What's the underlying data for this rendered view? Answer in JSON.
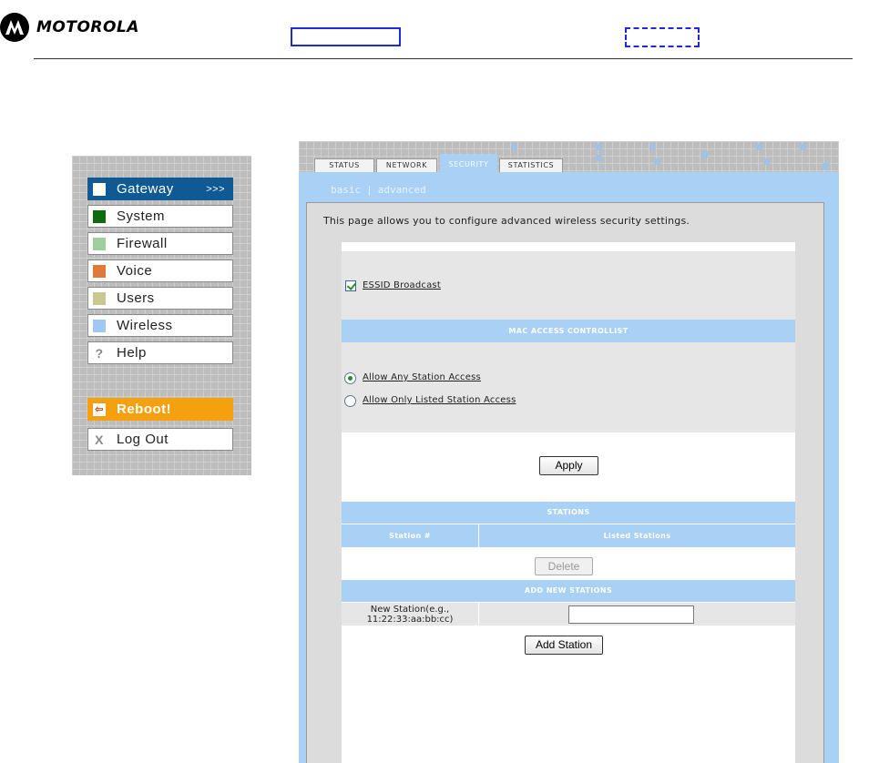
{
  "brand": {
    "name": "MOTOROLA",
    "logo_icon": "motorola-batwing-icon"
  },
  "sidebar": {
    "items": [
      {
        "label": "Gateway",
        "chevron": ">>>",
        "color": "#ffffff"
      },
      {
        "label": "System",
        "color": "#0e6b0e"
      },
      {
        "label": "Firewall",
        "color": "#9fcf9f"
      },
      {
        "label": "Voice",
        "color": "#e07a3a"
      },
      {
        "label": "Users",
        "color": "#c9c98f"
      },
      {
        "label": "Wireless",
        "color": "#9fc9f2"
      },
      {
        "label": "Help",
        "glyph": "?"
      },
      {
        "label": "Reboot!",
        "glyph": "⇦"
      },
      {
        "label": "Log Out",
        "glyph": "X"
      }
    ]
  },
  "tabs": [
    {
      "label": "STATUS"
    },
    {
      "label": "NETWORK"
    },
    {
      "label": "SECURITY",
      "active": true
    },
    {
      "label": "STATISTICS"
    }
  ],
  "subnav": {
    "basic": "basic",
    "separator": "|",
    "advanced": "advanced"
  },
  "page": {
    "intro": "This page allows you to configure advanced wireless security settings.",
    "essid_label": "ESSID Broadcast",
    "essid_checked": true,
    "mac_header": "MAC ACCESS CONTROLLIST",
    "radio_any": "Allow Any Station Access",
    "radio_listed": "Allow Only Listed Station Access",
    "apply_label": "Apply",
    "stations_header": "STATIONS",
    "col_station": "Station #",
    "col_listed": "Listed Stations",
    "delete_label": "Delete",
    "add_header": "ADD NEW STATIONS",
    "new_station_label": "New Station(e.g., 11:22:33:aa:bb:cc)",
    "new_station_value": "",
    "add_station_label": "Add Station"
  },
  "colors": {
    "accent": "#a9d0f5",
    "gateway_active": "#0f5a95",
    "reboot": "#f5a10f"
  }
}
